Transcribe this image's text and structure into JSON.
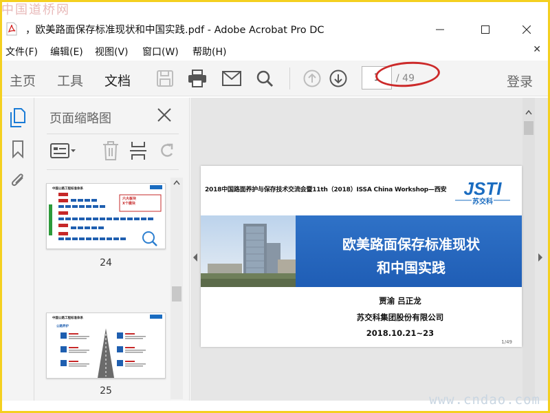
{
  "watermarks": {
    "top": "中国道桥网",
    "bottom": "www.cndao.com"
  },
  "window": {
    "title": "，欧美路面保存标准现状和中国实践.pdf - Adobe Acrobat Pro DC",
    "icon": "pdf-file-icon"
  },
  "menu": {
    "items": [
      {
        "label": "文件(F)"
      },
      {
        "label": "编辑(E)"
      },
      {
        "label": "视图(V)"
      },
      {
        "label": "窗口(W)"
      },
      {
        "label": "帮助(H)"
      }
    ],
    "close_glyph": "✕"
  },
  "toolbar": {
    "tabs": [
      {
        "label": "主页",
        "active": false
      },
      {
        "label": "工具",
        "active": false
      },
      {
        "label": "文档",
        "active": true
      }
    ],
    "icons": [
      "save-icon",
      "print-icon",
      "mail-icon",
      "search-icon",
      "page-up-icon",
      "page-down-icon"
    ],
    "page_input": "1",
    "page_total": "/ 49",
    "login": "登录"
  },
  "thumbnail_panel": {
    "title": "页面缩略图",
    "thumbs": [
      {
        "page_label": "24",
        "heading": "中国公路工程标准体系",
        "callout_lines": [
          "六大板块",
          "X个模块"
        ]
      },
      {
        "page_label": "25",
        "heading": "中国公路工程标准体系",
        "section": "公路养护"
      }
    ]
  },
  "slide": {
    "header": "2018中国路面养护与保存技术交流会暨11th（2018）ISSA China Workshop—西安",
    "logo_text": "JSTI",
    "logo_sub": "苏交科",
    "title_line1": "欧美路面保存标准现状",
    "title_line2": "和中国实践",
    "authors": "贾渝  吕正龙",
    "company": "苏交科集团股份有限公司",
    "date": "2018.10.21~23",
    "page_number": "1/49"
  },
  "colors": {
    "frame": "#f4d020",
    "highlight": "#cc2a2a",
    "slide_band": "#2f72c7",
    "logo_blue": "#1a6cc0"
  }
}
